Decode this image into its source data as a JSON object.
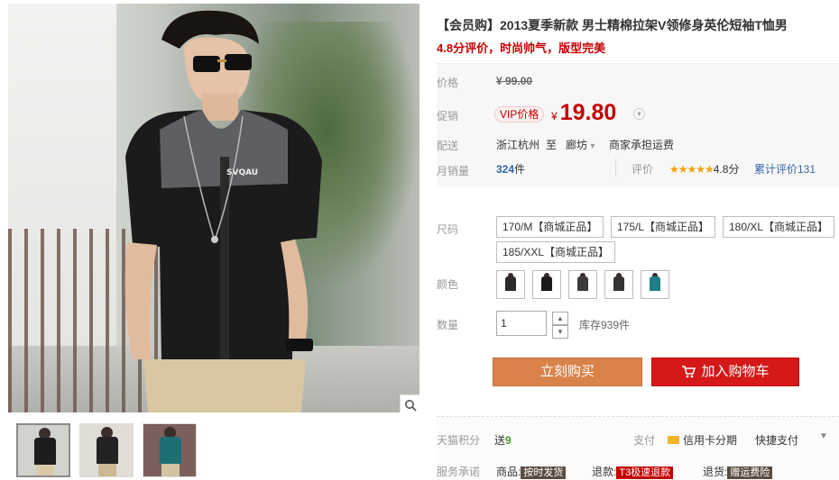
{
  "product": {
    "title": "【会员购】2013夏季新款 男士精棉拉架V领修身英伦短袖T恤男",
    "subtitle": "4.8分评价，时尚帅气，版型完美"
  },
  "price": {
    "label": "价格",
    "original": "¥ 99.00",
    "promo_label": "促销",
    "vip_badge": "VIP价格",
    "currency": "¥",
    "promo_value": "19.80"
  },
  "shipping": {
    "label": "配送",
    "from": "浙江杭州",
    "to_word": "至",
    "destination": "廊坊",
    "fee": "商家承担运费"
  },
  "sales": {
    "label": "月销量",
    "count": "324",
    "unit": "件",
    "rating_label": "评价",
    "stars": "★★★★★",
    "score": "4.8分",
    "total_reviews": "累计评价131"
  },
  "sizes": {
    "label": "尺码",
    "options": [
      "170/M【商城正品】",
      "175/L【商城正品】",
      "180/XL【商城正品】",
      "185/XXL【商城正品】"
    ]
  },
  "colors": {
    "label": "颜色",
    "swatches": [
      "#2a2a2a",
      "#1b1b1b",
      "#3a3a3a",
      "#333333",
      "#1f7f86"
    ]
  },
  "quantity": {
    "label": "数量",
    "value": "1",
    "stock": "库存939件"
  },
  "actions": {
    "buy_now": "立刻购买",
    "add_to_cart": "加入购物车"
  },
  "points": {
    "label": "天猫积分",
    "value_prefix": "送",
    "value": "9",
    "pay_label": "支付",
    "installment": "信用卡分期",
    "quick_pay": "快捷支付"
  },
  "service": {
    "label": "服务承诺",
    "item1_label": "商品:",
    "item1_tag": "按时发货",
    "item2_label": "退款:",
    "item2_tag": "T3极速退款",
    "item3_label": "退货:",
    "item3_tag": "赠运费险"
  },
  "colors_theme": {
    "accent_red": "#c40000",
    "buy_orange": "#d9834a",
    "cart_red": "#d51818"
  }
}
